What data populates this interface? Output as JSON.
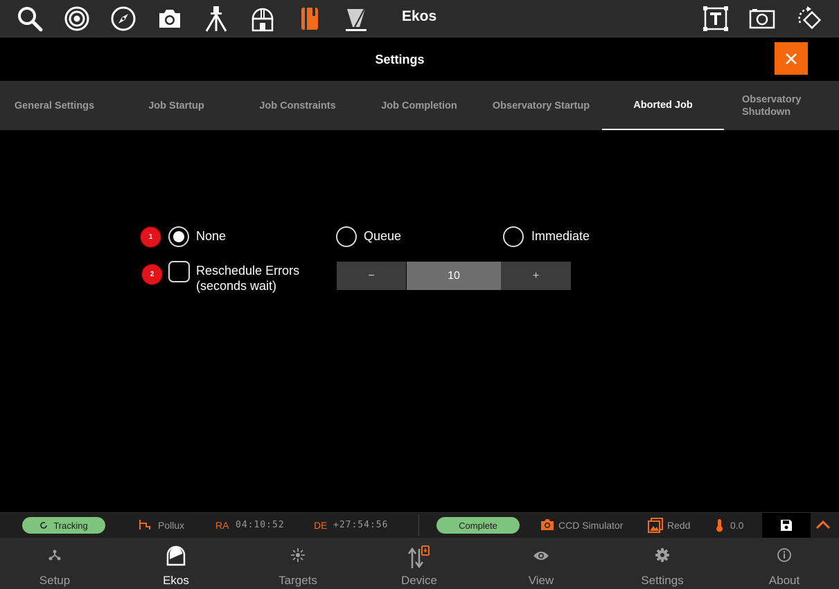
{
  "toolbar": {
    "title": "Ekos",
    "icons": [
      "search-icon",
      "target-icon",
      "compass-icon",
      "camera-icon",
      "tripod-icon",
      "observatory-icon",
      "scheduler-icon",
      "flat-field-icon",
      "text-frame-icon",
      "capture-frame-icon",
      "rotate-icon"
    ]
  },
  "settings": {
    "title": "Settings",
    "close_label": "×"
  },
  "tabs": [
    {
      "label": "General Settings"
    },
    {
      "label": "Job Startup"
    },
    {
      "label": "Job Constraints"
    },
    {
      "label": "Job Completion"
    },
    {
      "label": "Observatory Startup"
    },
    {
      "label": "Aborted Job"
    },
    {
      "label": "Observatory Shutdown"
    }
  ],
  "active_tab": "Aborted Job",
  "content": {
    "badge1": "1",
    "badge2": "2",
    "radio_options": [
      {
        "label": "None",
        "checked": true
      },
      {
        "label": "Queue",
        "checked": false
      },
      {
        "label": "Immediate",
        "checked": false
      }
    ],
    "reschedule_label_line1": "Reschedule Errors",
    "reschedule_label_line2": "(seconds wait)",
    "reschedule_checked": false,
    "stepper": {
      "minus": "−",
      "value": "10",
      "plus": "+"
    }
  },
  "statusbar": {
    "tracking": "Tracking",
    "target": "Pollux",
    "ra_label": "RA",
    "ra_value": "04:10:52",
    "de_label": "DE",
    "de_value": "+27:54:56",
    "complete": "Complete",
    "camera": "CCD Simulator",
    "filter": "Redd",
    "temperature": "0.0"
  },
  "nav": [
    {
      "label": "Setup"
    },
    {
      "label": "Ekos"
    },
    {
      "label": "Targets"
    },
    {
      "label": "Device"
    },
    {
      "label": "View"
    },
    {
      "label": "Settings"
    },
    {
      "label": "About"
    }
  ],
  "colors": {
    "accent": "#f5670c",
    "status_green": "#7ec47e",
    "badge_red": "#e0141a"
  }
}
